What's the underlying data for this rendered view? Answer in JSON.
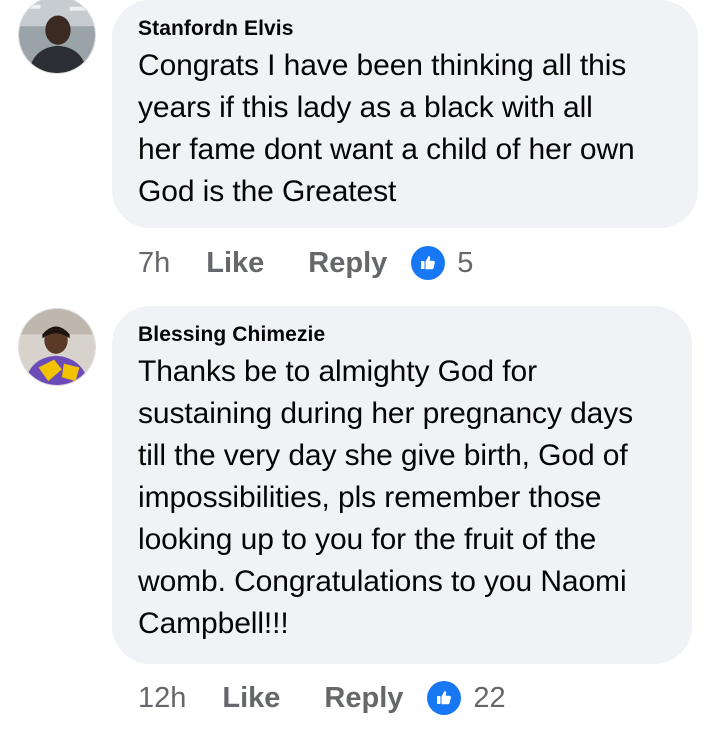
{
  "comments": [
    {
      "author": "Stanfordn Elvis",
      "text": "Congrats I have been thinking all this\nyears if this lady as a black with all\nher fame dont want a child of her own\nGod is the Greatest",
      "time": "7h",
      "like_label": "Like",
      "reply_label": "Reply",
      "reaction_icon": "like-thumbs-up-icon",
      "reaction_count": "5"
    },
    {
      "author": "Blessing Chimezie",
      "text": "Thanks be to almighty God for\nsustaining during her pregnancy days\ntill the very day she give birth, God of\nimpossibilities, pls remember those\nlooking up to you for the fruit of the\nwomb. Congratulations to you Naomi\nCampbell!!!",
      "time": "12h",
      "like_label": "Like",
      "reply_label": "Reply",
      "reaction_icon": "like-thumbs-up-icon",
      "reaction_count": "22"
    }
  ],
  "colors": {
    "bubble_bg": "#f0f2f5",
    "secondary_text": "#65676b",
    "like_blue": "#1877f2"
  }
}
